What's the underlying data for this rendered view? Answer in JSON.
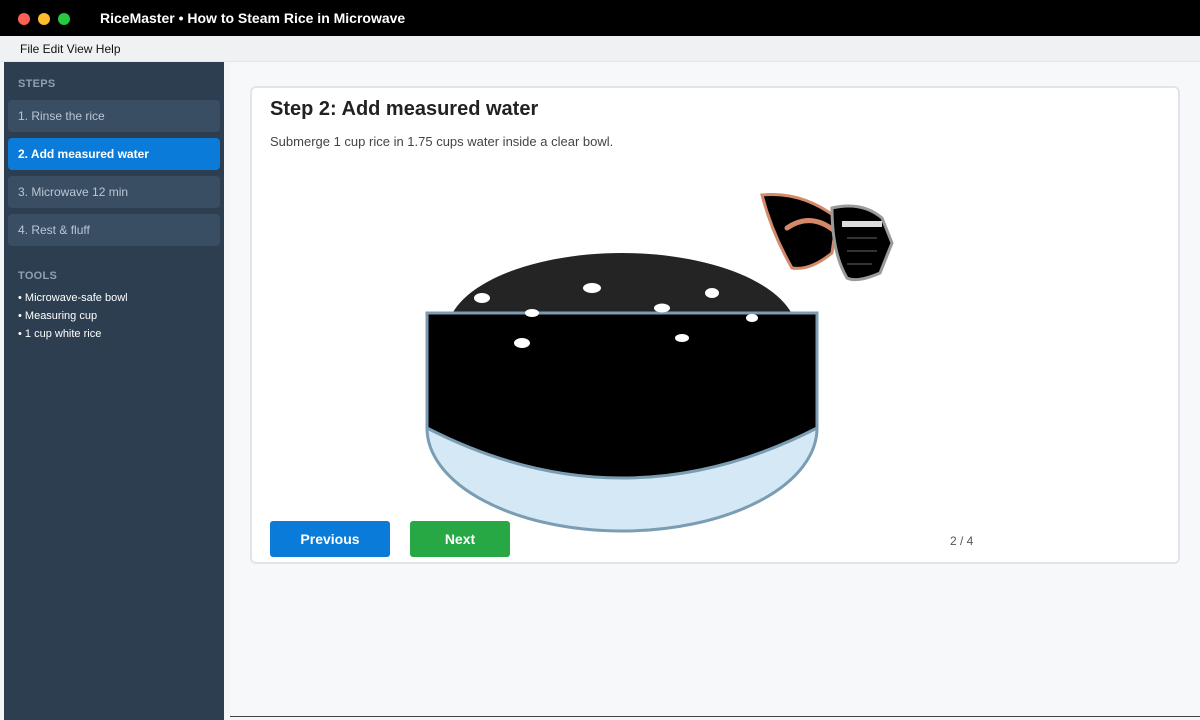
{
  "window": {
    "title": "RiceMaster • How to Steam Rice in Microwave"
  },
  "menubar": {
    "text": "File Edit View Help"
  },
  "sidebar": {
    "steps_label": "STEPS",
    "steps": [
      {
        "label": "1. Rinse the rice"
      },
      {
        "label": "2. Add measured water"
      },
      {
        "label": "3. Microwave 12 min"
      },
      {
        "label": "4. Rest & fluff"
      }
    ],
    "tools_label": "TOOLS",
    "tools": [
      {
        "label": "• Microwave-safe bowl"
      },
      {
        "label": "• Measuring cup"
      },
      {
        "label": "• 1 cup white rice"
      }
    ]
  },
  "main": {
    "title": "Step 2: Add measured water",
    "description": "Submerge 1 cup rice in 1.75 cups water inside a clear bowl.",
    "previous_label": "Previous",
    "next_label": "Next",
    "page_indicator": "2 / 4"
  },
  "colors": {
    "accent": "#0a7bd8",
    "next_button": "#28a745",
    "sidebar_bg": "#2c3e50",
    "bowl_outline": "#7b9db3",
    "bowl_fill": "#d5e8f5",
    "cup_handle": "#d4896a"
  }
}
